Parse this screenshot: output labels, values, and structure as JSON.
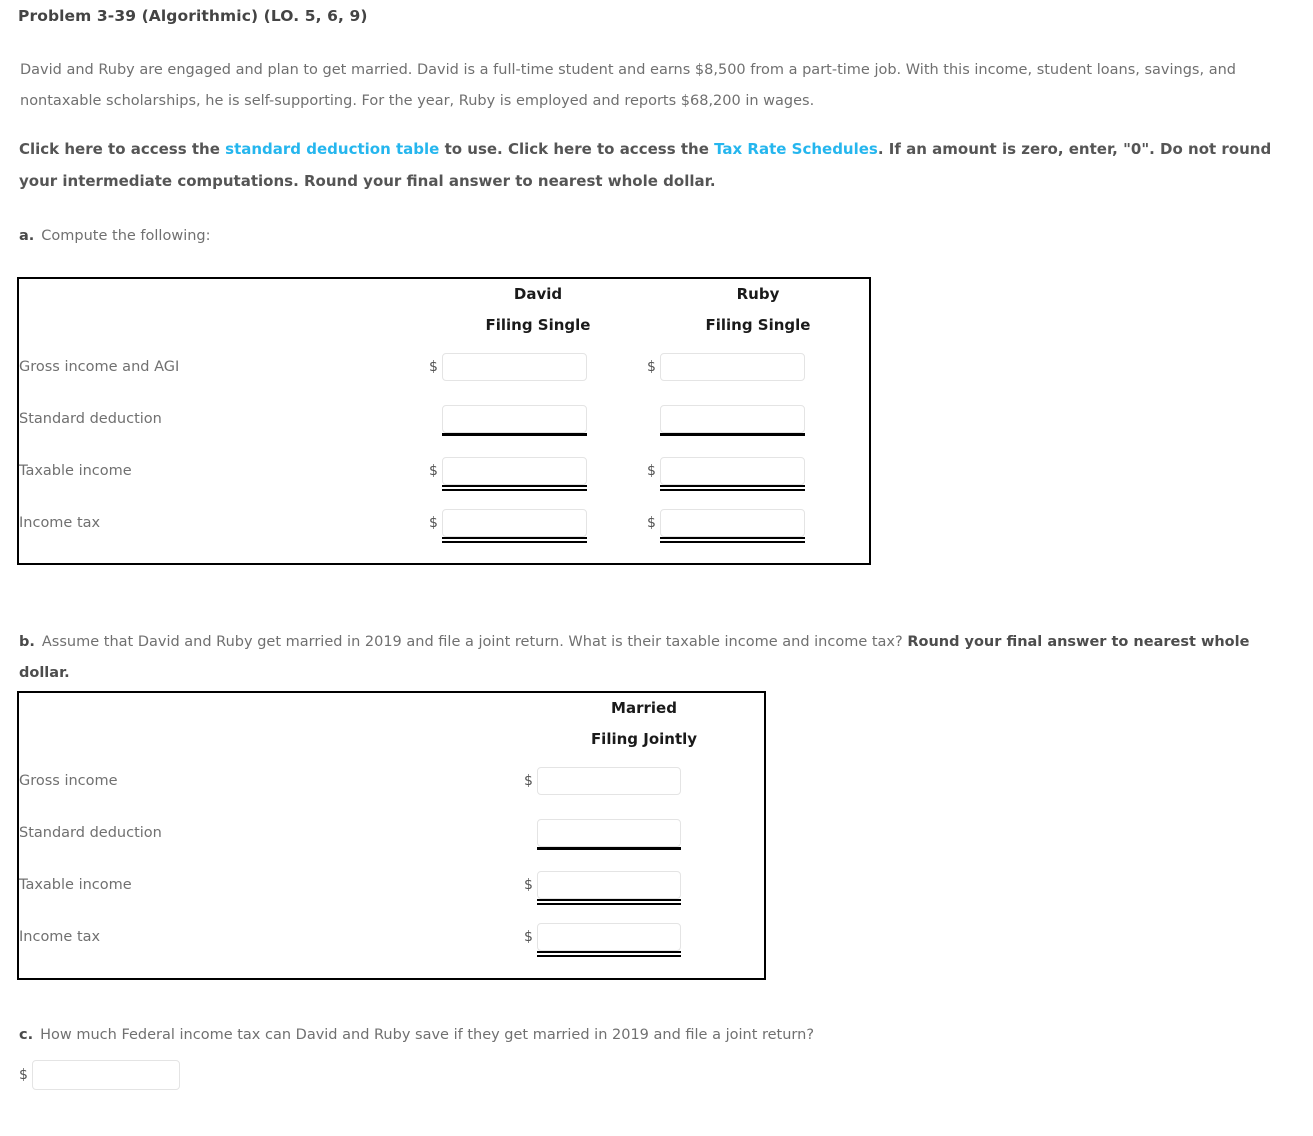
{
  "problem": {
    "title": "Problem 3-39 (Algorithmic) (LO. 5, 6, 9)",
    "intro": "David and Ruby are engaged and plan to get married. David is a full-time student and earns $8,500 from a part-time job. With this income, student loans, savings, and nontaxable scholarships, he is self-supporting. For the year, Ruby is employed and reports $68,200 in wages."
  },
  "instructions": {
    "lead": "Click here to access the ",
    "link_standard_deduction": "standard deduction table",
    "middle": " to use. Click here to access the ",
    "link_tax_rate_schedules": "Tax Rate Schedules",
    "tail": ". If an amount is zero, enter, \"0\". Do not round your intermediate computations. Round your final answer to nearest whole dollar."
  },
  "part_a": {
    "label": "a.",
    "text": "Compute the following:",
    "columns": [
      {
        "name": "David",
        "filing_status": "Filing Single"
      },
      {
        "name": "Ruby",
        "filing_status": "Filing Single"
      }
    ],
    "rows": [
      {
        "label": "Gross income and AGI",
        "dollar": true,
        "rule": "none",
        "david": "",
        "ruby": ""
      },
      {
        "label": "Standard deduction",
        "dollar": false,
        "rule": "single",
        "david": "",
        "ruby": ""
      },
      {
        "label": "Taxable income",
        "dollar": true,
        "rule": "double",
        "david": "",
        "ruby": ""
      },
      {
        "label": "Income tax",
        "dollar": true,
        "rule": "double",
        "david": "",
        "ruby": ""
      }
    ]
  },
  "part_b": {
    "label": "b.",
    "text": "Assume that David and Ruby get married in 2019 and file a joint return. What is their taxable income and income tax? ",
    "text_bold": "Round your final answer to nearest whole dollar.",
    "column": {
      "name": "Married",
      "filing_status": "Filing Jointly"
    },
    "rows": [
      {
        "label": "Gross income",
        "dollar": true,
        "rule": "none",
        "value": ""
      },
      {
        "label": "Standard deduction",
        "dollar": false,
        "rule": "single",
        "value": ""
      },
      {
        "label": "Taxable income",
        "dollar": true,
        "rule": "double",
        "value": ""
      },
      {
        "label": "Income tax",
        "dollar": true,
        "rule": "double",
        "value": ""
      }
    ]
  },
  "part_c": {
    "label": "c.",
    "text": "How much Federal income tax can David and Ruby save if they get married in 2019 and file a joint return?",
    "dollar_symbol": "$",
    "value": "",
    "placeholder": ""
  },
  "symbols": {
    "dollar": "$"
  },
  "colors": {
    "link": "#25b6ee",
    "body_text": "#707070",
    "heading_text": "#444444",
    "table_border": "#000000",
    "input_border": "#e4e4e4"
  }
}
